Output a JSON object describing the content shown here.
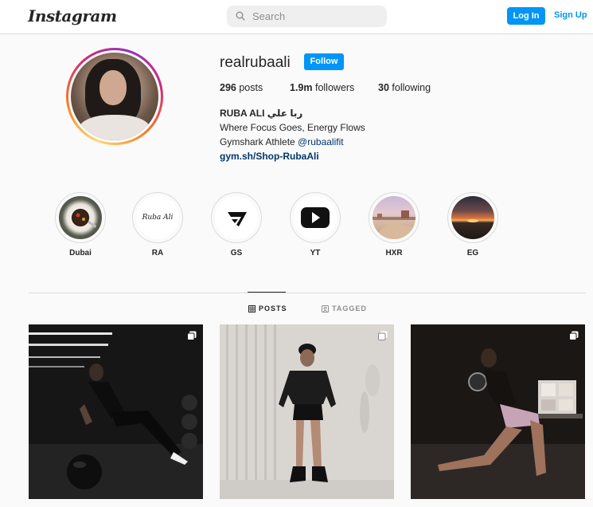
{
  "topbar": {
    "logo_text": "Instagram",
    "search_placeholder": "Search",
    "login_label": "Log In",
    "signup_label": "Sign Up"
  },
  "profile": {
    "username": "realrubaali",
    "follow_label": "Follow",
    "stats": {
      "posts_count": "296",
      "posts_label": "posts",
      "followers_count": "1.9m",
      "followers_label": "followers",
      "following_count": "30",
      "following_label": "following"
    },
    "bio": {
      "name": "RUBA ALI ربا علي",
      "line1": "Where Focus Goes, Energy Flows",
      "line2_prefix": "Gymshark Athlete ",
      "mention": "@rubaalifit",
      "link": "gym.sh/Shop-RubaAli"
    }
  },
  "highlights": [
    {
      "label": "Dubai",
      "icon": "coffee-cup-photo"
    },
    {
      "label": "RA",
      "icon": "signature-logo",
      "logo_text": "Ruba Ali"
    },
    {
      "label": "GS",
      "icon": "gymshark-logo"
    },
    {
      "label": "YT",
      "icon": "youtube-logo"
    },
    {
      "label": "HXR",
      "icon": "beach-photo"
    },
    {
      "label": "EG",
      "icon": "sunset-photo"
    }
  ],
  "tabs": {
    "posts_label": "POSTS",
    "tagged_label": "TAGGED",
    "active": "POSTS"
  },
  "posts": [
    {
      "alt": "gym-medicine-ball-photo",
      "multiple": true
    },
    {
      "alt": "standing-pose-photo",
      "multiple": true
    },
    {
      "alt": "kettlebell-lunge-photo",
      "multiple": true
    }
  ],
  "colors": {
    "accent": "#0095f6",
    "link": "#00376b",
    "text": "#262626",
    "muted": "#8e8e8e",
    "border": "#dbdbdb",
    "background": "#fafafa"
  }
}
